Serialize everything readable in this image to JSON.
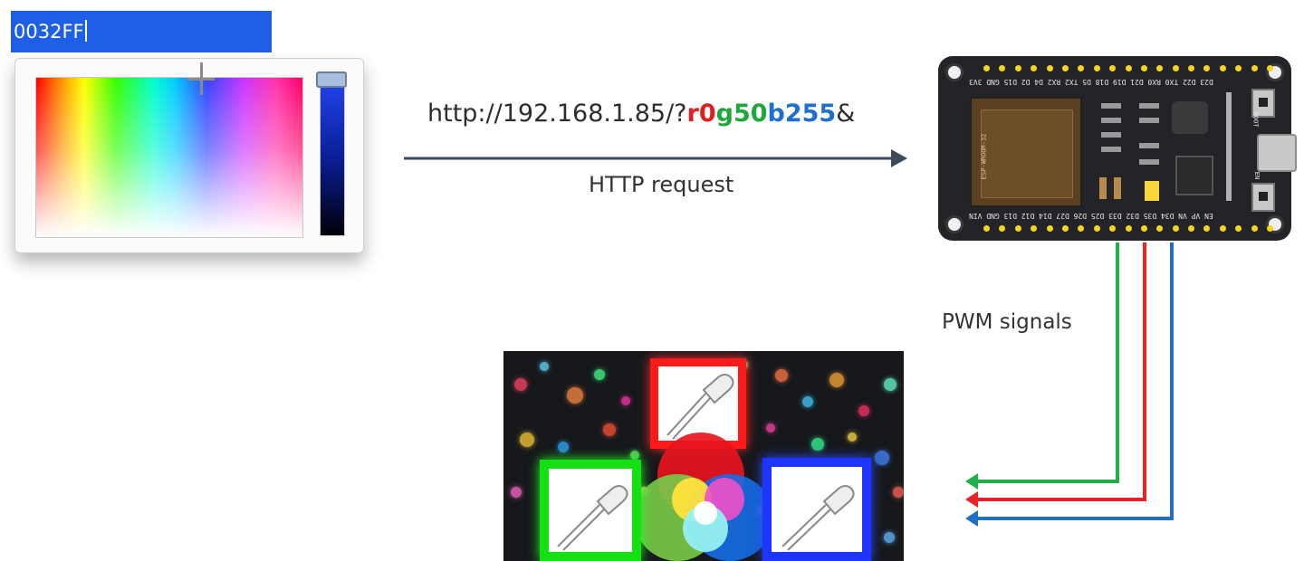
{
  "color_picker": {
    "hex_value": "0032FF"
  },
  "request": {
    "url_prefix": "http://192.168.1.85/?",
    "params": [
      {
        "key": "r",
        "value": "0",
        "color": "#e02020"
      },
      {
        "key": "g",
        "value": "50",
        "color": "#1fa83a"
      },
      {
        "key": "b",
        "value": "255",
        "color": "#1e6fd0"
      }
    ],
    "url_suffix": "&",
    "label": "HTTP request"
  },
  "pwm": {
    "label": "PWM signals",
    "wire_colors": [
      "#22b04b",
      "#e8232b",
      "#1f6fc5"
    ]
  },
  "board": {
    "module_text": "ESP-WROOM-32",
    "top_pins_text": "D23 D22 TX0 RX0 D21 D19 D18 D5 TX2 RX2 D4 D2 D15 GND 3V3",
    "bottom_pins_text": "EN VP VN D34 D35 D32 D33 D25 D26 D27 D14 D12 D13 GND VIN",
    "boot_label": "BOOT",
    "en_label": "EN",
    "pin_color": "#f5d61c"
  },
  "led_colors": {
    "red": "#ff1a1a",
    "green": "#14e014",
    "blue": "#1d35ff"
  }
}
